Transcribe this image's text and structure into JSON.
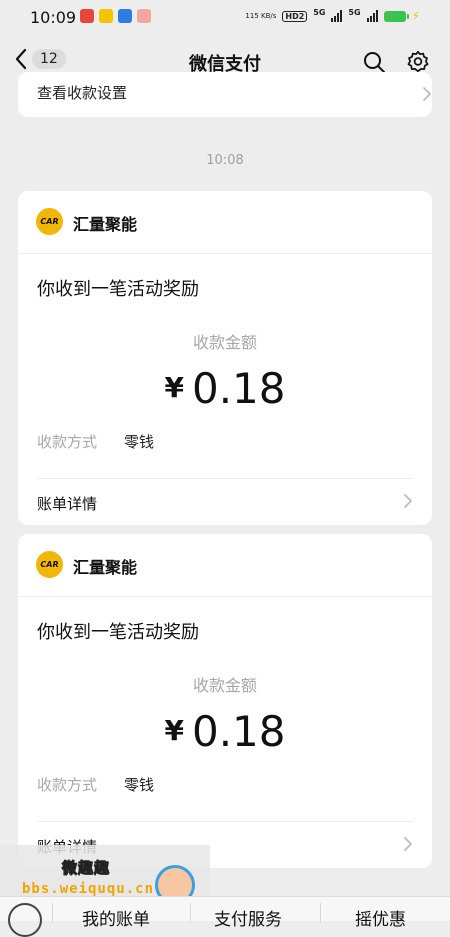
{
  "status_bar": {
    "time": "10:09",
    "net_speed": "115 KB/s",
    "hd_badge": "HD2",
    "net1": "5G",
    "net2": "5G",
    "app_icon_colors": [
      "#e8453c",
      "#f5c400",
      "#2f7de1",
      "#e8453c"
    ]
  },
  "nav": {
    "back_count": "12",
    "title": "微信支付"
  },
  "top_partial_card": {
    "text": "查看收款设置"
  },
  "time_separator": "10:08",
  "messages": [
    {
      "merchant_name": "汇量聚能",
      "logo_text": "CAR",
      "title": "你收到一笔活动奖励",
      "amount_label": "收款金额",
      "currency": "¥",
      "amount": "0.18",
      "method_label": "收款方式",
      "method_value": "零钱",
      "detail_label": "账单详情"
    },
    {
      "merchant_name": "汇量聚能",
      "logo_text": "CAR",
      "title": "你收到一笔活动奖励",
      "amount_label": "收款金额",
      "currency": "¥",
      "amount": "0.18",
      "method_label": "收款方式",
      "method_value": "零钱",
      "detail_label": "账单详情"
    }
  ],
  "watermark": {
    "title": "微趣趣",
    "url": "bbs.weiququ.cn"
  },
  "bottom_menu": {
    "items": [
      "我的账单",
      "支付服务",
      "摇优惠"
    ]
  },
  "colors": {
    "background": "#ededed",
    "card": "#ffffff",
    "logo": "#f2b705",
    "muted_text": "#a8a8a8"
  }
}
